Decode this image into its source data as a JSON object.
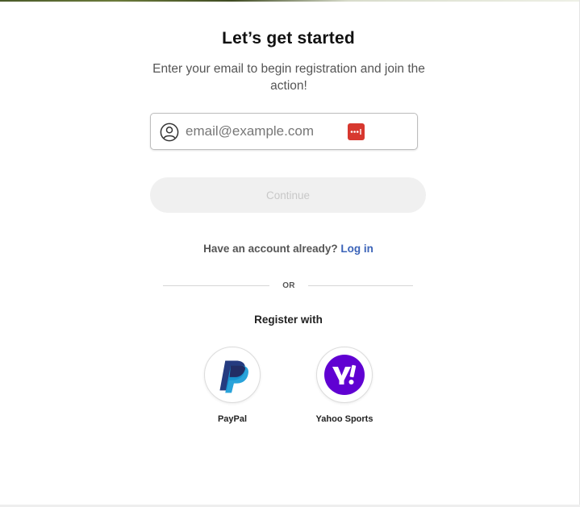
{
  "page": {
    "title": "Let’s get started",
    "subtitle": "Enter your email to begin registration and join the action!"
  },
  "email": {
    "placeholder": "email@example.com",
    "value": ""
  },
  "continue_label": "Continue",
  "login": {
    "prompt": "Have an account already?",
    "link_label": "Log in"
  },
  "divider_label": "OR",
  "register_with_label": "Register with",
  "providers": [
    {
      "label": "PayPal",
      "icon": "paypal-logo"
    },
    {
      "label": "Yahoo Sports",
      "icon": "yahoo-logo"
    }
  ],
  "colors": {
    "link": "#3b63b8",
    "yahoo_purple": "#6001d2",
    "paypal_dark": "#253b80",
    "paypal_light": "#179bd7",
    "password_manager_red": "#d7382f",
    "disabled_button_bg": "#f0f0f0"
  }
}
